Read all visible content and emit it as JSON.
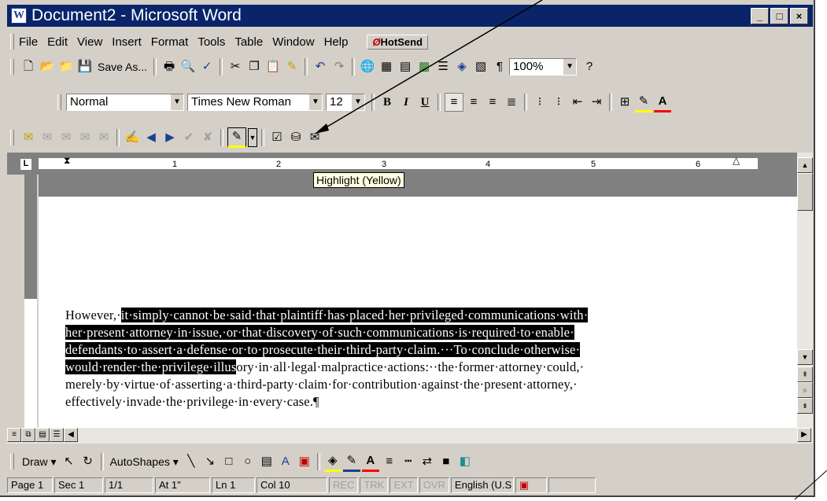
{
  "window": {
    "title": "Document2 - Microsoft Word",
    "app_icon": "W",
    "minimize": "_",
    "maximize": "□",
    "close": "×"
  },
  "menu": {
    "items": [
      "File",
      "Edit",
      "View",
      "Insert",
      "Format",
      "Tools",
      "Table",
      "Window",
      "Help"
    ],
    "hotsend": "HotSend"
  },
  "standard_toolbar": {
    "save_as": "Save As...",
    "zoom": "100%"
  },
  "formatting_toolbar": {
    "style": "Normal",
    "font": "Times New Roman",
    "size": "12",
    "bold": "B",
    "italic": "I",
    "underline": "U"
  },
  "ruler": {
    "numbers": [
      "1",
      "2",
      "3",
      "4",
      "5",
      "6"
    ],
    "tab_selector": "L"
  },
  "tooltip": "Highlight (Yellow)",
  "document": {
    "paragraph_plain_start": "However,·",
    "highlighted": "it·simply·cannot·be·said·that·plaintiff·has·placed·her·privileged·communications·with· her·present·attorney·in·issue,·or·that·discovery·of·such·communications·is·required·to·enable· defendants·to·assert·a·defense·or·to·prosecute·their·third-party·claim.···To·conclude·otherwise· would·render·the·privilege·illus",
    "paragraph_plain_end": "ory·in·all·legal·malpractice·actions:··the·former·attorney·could,· merely·by·virtue·of·asserting·a·third-party·claim·for·contribution·against·the·present·attorney,· effectively·invade·the·privilege·in·every·case.¶"
  },
  "drawing_toolbar": {
    "draw": "Draw",
    "autoshapes": "AutoShapes"
  },
  "status": {
    "page": "Page 1",
    "sec": "Sec 1",
    "pages": "1/1",
    "at": "At 1\"",
    "ln": "Ln 1",
    "col": "Col 10",
    "rec": "REC",
    "trk": "TRK",
    "ext": "EXT",
    "ovr": "OVR",
    "lang": "English (U.S"
  },
  "colors": {
    "title_bar": "#0a246a",
    "highlight_color": "#ffff00",
    "chrome": "#d4d0c8"
  }
}
